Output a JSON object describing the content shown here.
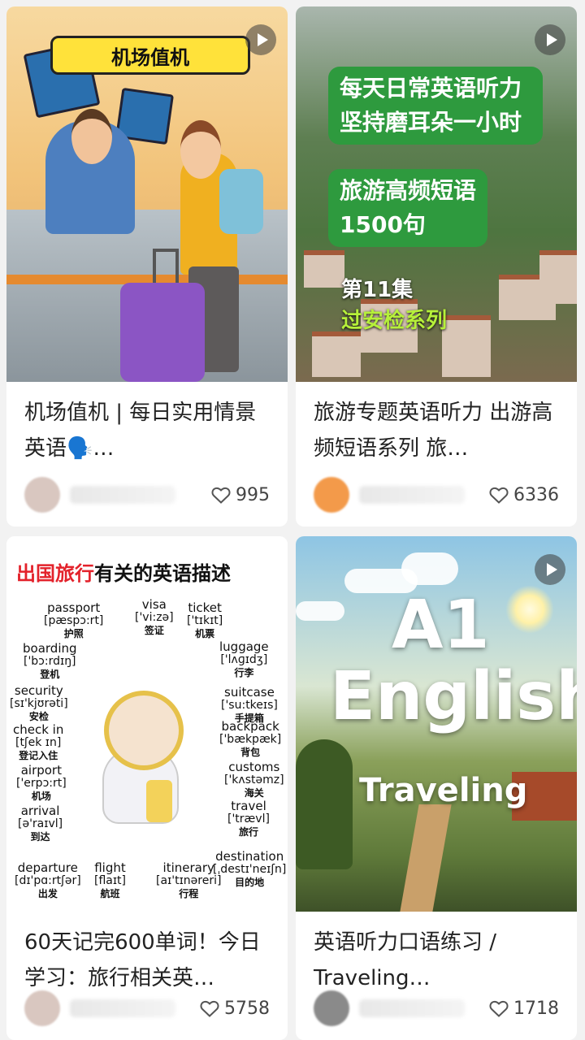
{
  "cards": [
    {
      "title": "机场值机 | 每日实用情景英语🗣️…",
      "thumb_label": "机场值机",
      "likes": "995",
      "author_partial": "…日英…"
    },
    {
      "title": "旅游专题英语听力 出游高频短语系列 旅…",
      "box1": "每天日常英语听力坚持磨耳朵一小时",
      "box2": "旅游高频短语1500句",
      "episode": "第11集",
      "series": "过安检系列",
      "likes": "6336",
      "author_partial": "语"
    },
    {
      "title": "60天记完600单词！今日学习：旅行相关英…",
      "header_red": "出国旅行",
      "header_black": "有关的英语描述",
      "vocab": [
        {
          "en": "passport",
          "ipa": "[pæspɔ:rt]",
          "zh": "护照"
        },
        {
          "en": "visa",
          "ipa": "['vi:zə]",
          "zh": "签证"
        },
        {
          "en": "ticket",
          "ipa": "['tɪkɪt]",
          "zh": "机票"
        },
        {
          "en": "boarding",
          "ipa": "['bɔ:rdɪŋ]",
          "zh": "登机"
        },
        {
          "en": "luggage",
          "ipa": "['lʌɡɪdʒ]",
          "zh": "行李"
        },
        {
          "en": "security",
          "ipa": "[sɪ'kjʊrəti]",
          "zh": "安检"
        },
        {
          "en": "suitcase",
          "ipa": "['su:tkeɪs]",
          "zh": "手提箱"
        },
        {
          "en": "check in",
          "ipa": "[tʃek ɪn]",
          "zh": "登记入住"
        },
        {
          "en": "backpack",
          "ipa": "['bækpæk]",
          "zh": "背包"
        },
        {
          "en": "airport",
          "ipa": "['erpɔ:rt]",
          "zh": "机场"
        },
        {
          "en": "customs",
          "ipa": "['kʌstəmz]",
          "zh": "海关"
        },
        {
          "en": "arrival",
          "ipa": "[ə'raɪvl]",
          "zh": "到达"
        },
        {
          "en": "travel",
          "ipa": "['trævl]",
          "zh": "旅行"
        },
        {
          "en": "departure",
          "ipa": "[dɪ'pɑ:rtʃər]",
          "zh": "出发"
        },
        {
          "en": "flight",
          "ipa": "[flaɪt]",
          "zh": "航班"
        },
        {
          "en": "itinerary",
          "ipa": "[aɪ'tɪnəreri]",
          "zh": "行程"
        },
        {
          "en": "destination",
          "ipa": "[ˌdestɪ'neɪʃn]",
          "zh": "目的地"
        }
      ],
      "likes": "5758"
    },
    {
      "title": "英语听力口语练习 / Traveling…",
      "a1": "A1",
      "english": "English",
      "traveling": "Traveling",
      "likes": "1718"
    }
  ],
  "icons": {
    "play": "play-icon",
    "heart": "heart-outline-icon"
  },
  "colors": {
    "title_green": "#2e9a3e",
    "series_lime": "#b6f03a",
    "header_red": "#e3222b",
    "label_yellow": "#ffe23a"
  }
}
